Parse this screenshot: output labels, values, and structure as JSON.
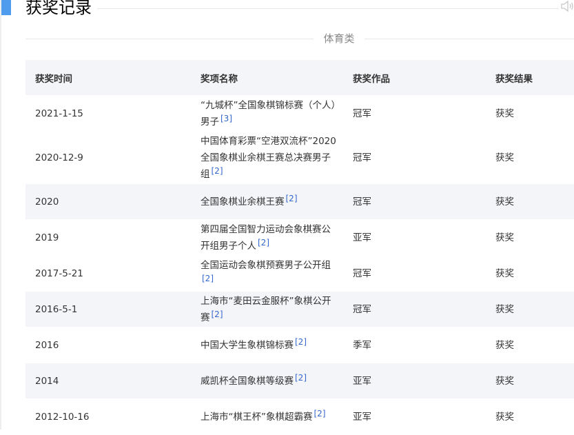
{
  "section": {
    "title": "获奖记录"
  },
  "category": "体育类",
  "table": {
    "headers": [
      "获奖时间",
      "奖项名称",
      "获奖作品",
      "获奖结果"
    ],
    "rows": [
      {
        "time": "2021-1-15",
        "name": "“九城杯”全国象棋锦标赛（个人）男子",
        "ref": "[3]",
        "work": "冠军",
        "result": "获奖"
      },
      {
        "time": "2020-12-9",
        "name": "中国体育彩票“空港双流杯”2020全国象棋业余棋王赛总决赛男子组",
        "ref": "[2]",
        "work": "冠军",
        "result": "获奖"
      },
      {
        "time": "2020",
        "name": "全国象棋业余棋王赛",
        "ref": "[2]",
        "work": "冠军",
        "result": "获奖"
      },
      {
        "time": "2019",
        "name": "第四届全国智力运动会象棋赛公开组男子个人",
        "ref": "[2]",
        "work": "亚军",
        "result": "获奖"
      },
      {
        "time": "2017-5-21",
        "name": "全国运动会象棋预赛男子公开组",
        "ref": "[2]",
        "work": "冠军",
        "result": "获奖"
      },
      {
        "time": "2016-5-1",
        "name": "上海市“麦田云金服杯”象棋公开赛",
        "ref": "[2]",
        "work": "冠军",
        "result": "获奖"
      },
      {
        "time": "2016",
        "name": "中国大学生象棋锦标赛",
        "ref": "[2]",
        "work": "季军",
        "result": "获奖"
      },
      {
        "time": "2014",
        "name": "威凯杯全国象棋等级赛",
        "ref": "[2]",
        "work": "亚军",
        "result": "获奖"
      },
      {
        "time": "2012-10-16",
        "name": "上海市“棋王杯”象棋超霸赛",
        "ref": "[2]",
        "work": "亚军",
        "result": "获奖"
      }
    ]
  },
  "icons": {
    "speaker": "speaker-icon"
  },
  "colors": {
    "accent": "#4f9cee",
    "ref_link": "#3366cc",
    "row_alt": "#f4f5f9"
  }
}
